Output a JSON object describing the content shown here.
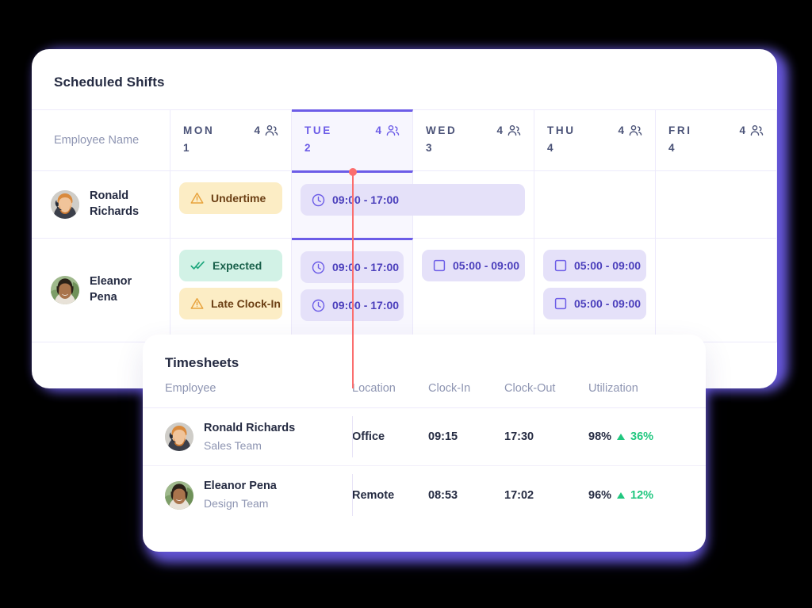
{
  "theme": {
    "accent": "#6C5CE7",
    "chip_time_bg": "#E5E1F9",
    "chip_time_fg": "#4B3FBC",
    "chip_warn_bg": "#FCEDC5",
    "chip_warn_fg": "#6B3F14",
    "chip_ok_bg": "#D2F2E6",
    "chip_ok_fg": "#18604A",
    "now_line": "#FB6E6E",
    "positive": "#21C77F"
  },
  "shifts": {
    "title": "Scheduled Shifts",
    "name_column_header": "Employee Name",
    "days": [
      {
        "dow": "MON",
        "date": "1",
        "count": "4",
        "active": false
      },
      {
        "dow": "TUE",
        "date": "2",
        "count": "4",
        "active": true
      },
      {
        "dow": "WED",
        "date": "3",
        "count": "4",
        "active": false
      },
      {
        "dow": "THU",
        "date": "4",
        "count": "4",
        "active": false
      },
      {
        "dow": "FRI",
        "date": "4",
        "count": "4",
        "active": false
      }
    ],
    "rows": [
      {
        "employee": "Ronald Richards",
        "mon": [
          {
            "type": "warn",
            "label": "Undertime",
            "icon": "warning-triangle-icon"
          }
        ],
        "tue_span": {
          "type": "time",
          "label": "09:00 - 17:00",
          "icon": "clock-icon"
        },
        "wed": [],
        "thu": [],
        "fri": []
      },
      {
        "employee": "Eleanor Pena",
        "mon": [
          {
            "type": "ok",
            "label": "Expected",
            "icon": "double-check-icon"
          },
          {
            "type": "warn",
            "label": "Late Clock-In",
            "icon": "warning-triangle-icon"
          }
        ],
        "tue": [
          {
            "type": "time",
            "label": "09:00 - 17:00",
            "icon": "clock-icon"
          },
          {
            "type": "time",
            "label": "09:00 - 17:00",
            "icon": "clock-icon"
          }
        ],
        "wed": [
          {
            "type": "time",
            "label": "05:00 - 09:00",
            "icon": "square-icon"
          }
        ],
        "thu": [
          {
            "type": "time",
            "label": "05:00 - 09:00",
            "icon": "square-icon"
          },
          {
            "type": "time",
            "label": "05:00 - 09:00",
            "icon": "square-icon"
          }
        ],
        "fri": []
      }
    ]
  },
  "timesheets": {
    "title": "Timesheets",
    "columns": [
      "Employee",
      "Location",
      "Clock-In",
      "Clock-Out",
      "Utilization"
    ],
    "rows": [
      {
        "name": "Ronald Richards",
        "team": "Sales Team",
        "location": "Office",
        "clock_in": "09:15",
        "clock_out": "17:30",
        "utilization": "98%",
        "delta": "36%",
        "delta_direction": "up"
      },
      {
        "name": "Eleanor Pena",
        "team": "Design Team",
        "location": "Remote",
        "clock_in": "08:53",
        "clock_out": "17:02",
        "utilization": "96%",
        "delta": "12%",
        "delta_direction": "up"
      }
    ]
  }
}
